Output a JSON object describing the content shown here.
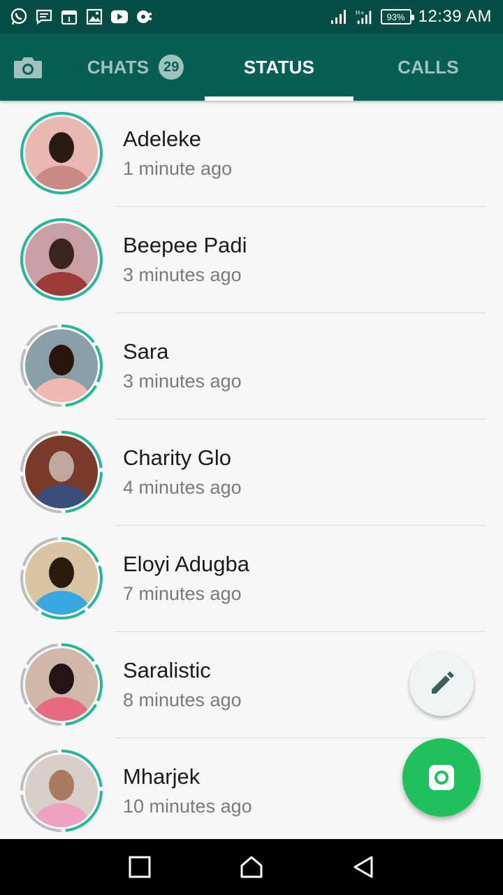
{
  "status_bar": {
    "time": "12:39 AM",
    "battery": "93%",
    "notification_icons": [
      "whatsapp-icon",
      "message-icon",
      "calendar-icon",
      "gallery-icon",
      "youtube-icon",
      "music-icon"
    ],
    "system_icons": [
      "signal-icon",
      "signal-ht-icon",
      "battery-icon"
    ]
  },
  "tabs": {
    "chats": {
      "label": "CHATS",
      "badge": "29"
    },
    "status": {
      "label": "STATUS"
    },
    "calls": {
      "label": "CALLS"
    }
  },
  "statuses": [
    {
      "name": "Adeleke",
      "time": "1 minute ago",
      "ring": "full"
    },
    {
      "name": "Beepee Padi",
      "time": "3 minutes ago",
      "ring": "full"
    },
    {
      "name": "Sara",
      "time": "3 minutes ago",
      "ring": "segmented"
    },
    {
      "name": "Charity Glo",
      "time": "4 minutes ago",
      "ring": "segmented"
    },
    {
      "name": "Eloyi Adugba",
      "time": "7 minutes ago",
      "ring": "segmented"
    },
    {
      "name": "Saralistic",
      "time": "8 minutes ago",
      "ring": "segmented"
    },
    {
      "name": "Mharjek",
      "time": "10 minutes ago",
      "ring": "segmented"
    }
  ],
  "colors": {
    "status_bar": "#054d44",
    "app_bar": "#075e54",
    "unseen_ring": "#25b79a",
    "seen_ring": "#bdbdbd",
    "fab_camera": "#20c05c"
  }
}
